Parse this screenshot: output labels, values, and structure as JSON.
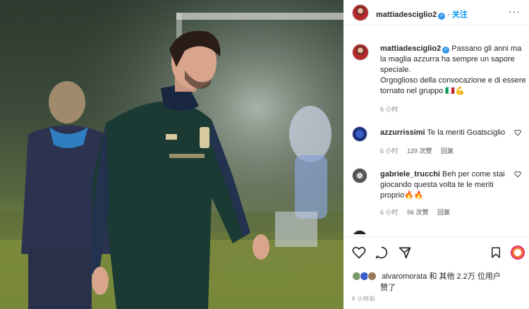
{
  "photo": {
    "alt_colors": {
      "jersey": "#1c3d35",
      "sky": "#2d3a2f",
      "grass": "#7b8a3d"
    }
  },
  "header": {
    "username": "mattiadesciglio2",
    "follow_label": "关注",
    "more_label": "···"
  },
  "caption": {
    "username": "mattiadesciglio2",
    "text_line1": "Passano gli anni ma la maglia azzurra ha sempre un sapore speciale.",
    "text_line2": "Orgoglioso della convocazione e di essere tornato nel gruppo 🇮🇹💪",
    "time": "6 小时"
  },
  "comments": [
    {
      "username": "azzurrissimi",
      "text": "Te la meriti Goatsciglio",
      "time": "6 小时",
      "likes": "120 次赞",
      "reply_label": "回复"
    },
    {
      "username": "gabriele_trucchi",
      "text": "Beh per come stai giocando questa volta te le meriti proprio🔥🔥",
      "time": "6 小时",
      "likes": "56 次赞",
      "reply_label": "回复"
    }
  ],
  "likes": {
    "text": "alvaromorata 和 其他 2.2万 位用户",
    "text2": "赞了"
  },
  "post_time": "6 小时前",
  "colors": {
    "accent": "#0095f6",
    "verified": "#3897f0",
    "muted": "#8e8e8e"
  }
}
